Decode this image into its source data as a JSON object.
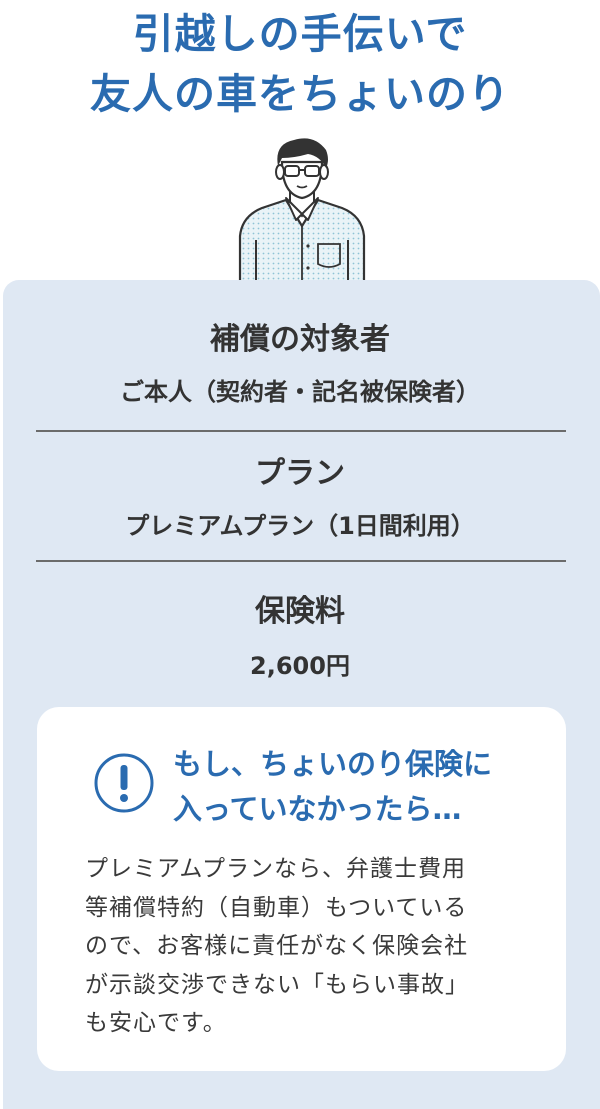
{
  "headline": {
    "line1": "引越しの手伝いで",
    "line2": "友人の車をちょいのり"
  },
  "person_icon": "person-illustration-icon",
  "info": {
    "target_label": "補償の対象者",
    "target_value": "ご本人（契約者・記名被保険者）",
    "plan_label": "プラン",
    "plan_value": "プレミアムプラン（1日間利用）",
    "fee_label": "保険料",
    "fee_value": "2,600円"
  },
  "note": {
    "icon": "exclamation-circle-icon",
    "title_line1": "もし、ちょいのり保険に",
    "title_line2": "入っていなかったら…",
    "body_lines": [
      "プレミアムプランなら、弁護士費用",
      "等補償特約（自動車）もついている",
      "ので、お客様に責任がなく保険会社",
      "が示談交渉できない「もらい事故」",
      "も安心です。"
    ]
  },
  "colors": {
    "accent": "#2a6bb0",
    "card_bg": "#dfe8f3",
    "note_bg": "#ffffff",
    "text": "#333333"
  }
}
